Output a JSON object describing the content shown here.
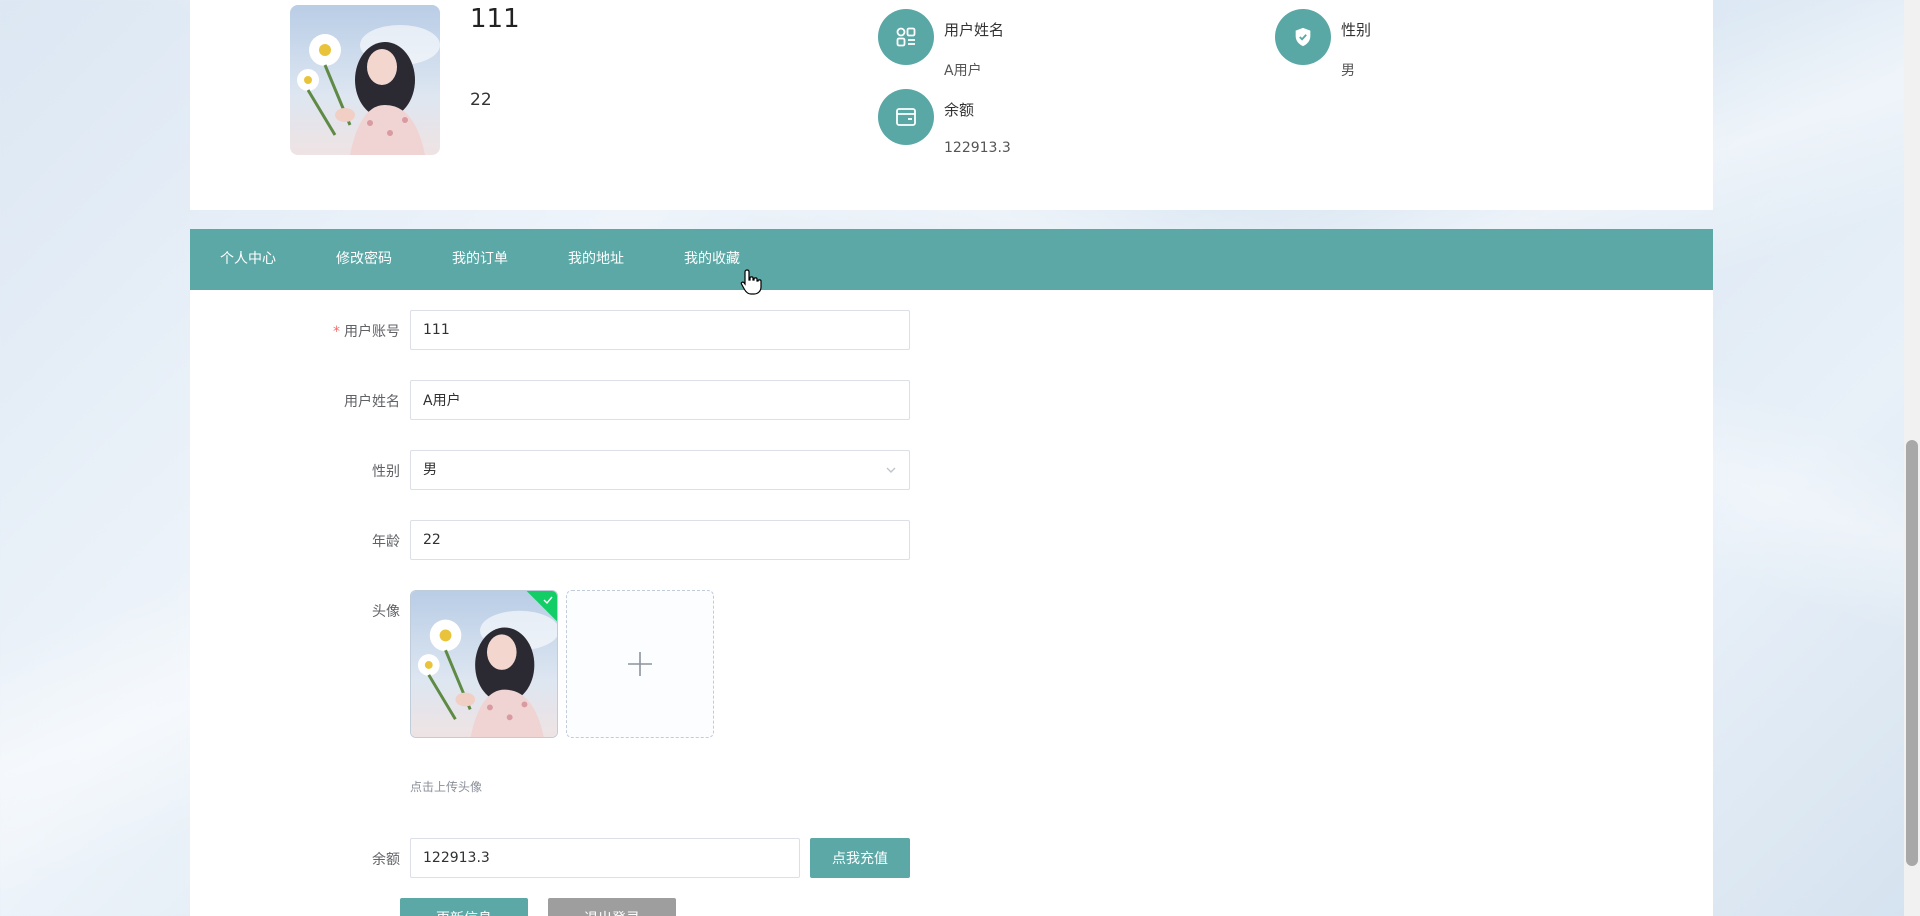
{
  "profile": {
    "name": "111",
    "age": "22",
    "info": [
      {
        "label": "用户姓名",
        "value": "A用户",
        "icon": "apps-icon"
      },
      {
        "label": "性别",
        "value": "男",
        "icon": "shield-icon"
      },
      {
        "label": "余额",
        "value": "122913.3",
        "icon": "wallet-icon"
      }
    ]
  },
  "nav": {
    "items": [
      {
        "label": "个人中心"
      },
      {
        "label": "修改密码"
      },
      {
        "label": "我的订单"
      },
      {
        "label": "我的地址"
      },
      {
        "label": "我的收藏"
      }
    ]
  },
  "form": {
    "account": {
      "label": "用户账号",
      "value": "111",
      "required": true
    },
    "realname": {
      "label": "用户姓名",
      "value": "A用户"
    },
    "gender": {
      "label": "性别",
      "value": "男"
    },
    "age": {
      "label": "年龄",
      "value": "22"
    },
    "avatar": {
      "label": "头像",
      "tip": "点击上传头像"
    },
    "balance": {
      "label": "余额",
      "value": "122913.3",
      "recharge_label": "点我充值"
    },
    "update_label": "更新信息",
    "logout_label": "退出登录"
  },
  "colors": {
    "accent": "#5ba8a6",
    "success": "#13ce66",
    "logout": "#9e9e9e"
  }
}
